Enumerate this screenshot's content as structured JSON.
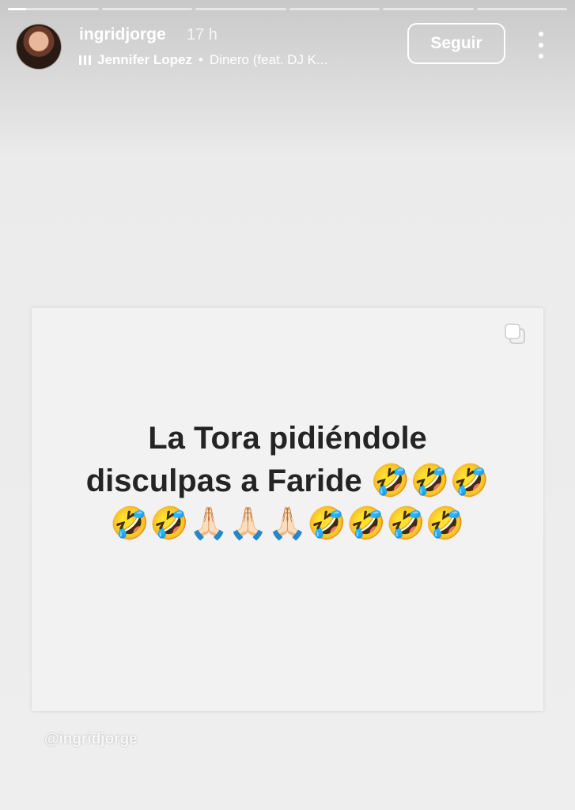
{
  "story": {
    "progress_segments": [
      1,
      0,
      0,
      0,
      0,
      0
    ],
    "active_segment_progress": 0.2
  },
  "header": {
    "avatar": "profile-photo",
    "username": "ingridjorge",
    "time": "17 h",
    "music": {
      "icon": "audio-bars-icon",
      "artist": "Jennifer Lopez",
      "separator": "•",
      "track": "Dinero (feat. DJ K..."
    },
    "follow_label": "Seguir",
    "more_icon": "more-vertical-icon"
  },
  "post": {
    "multi_icon": "multiple-images-icon",
    "text": "La Tora pidiéndole\ndisculpas a Faride 🤣🤣🤣\n🤣🤣🙏🏻🙏🏻🙏🏻🤣🤣🤣🤣"
  },
  "watermark": "@ingridjorge"
}
